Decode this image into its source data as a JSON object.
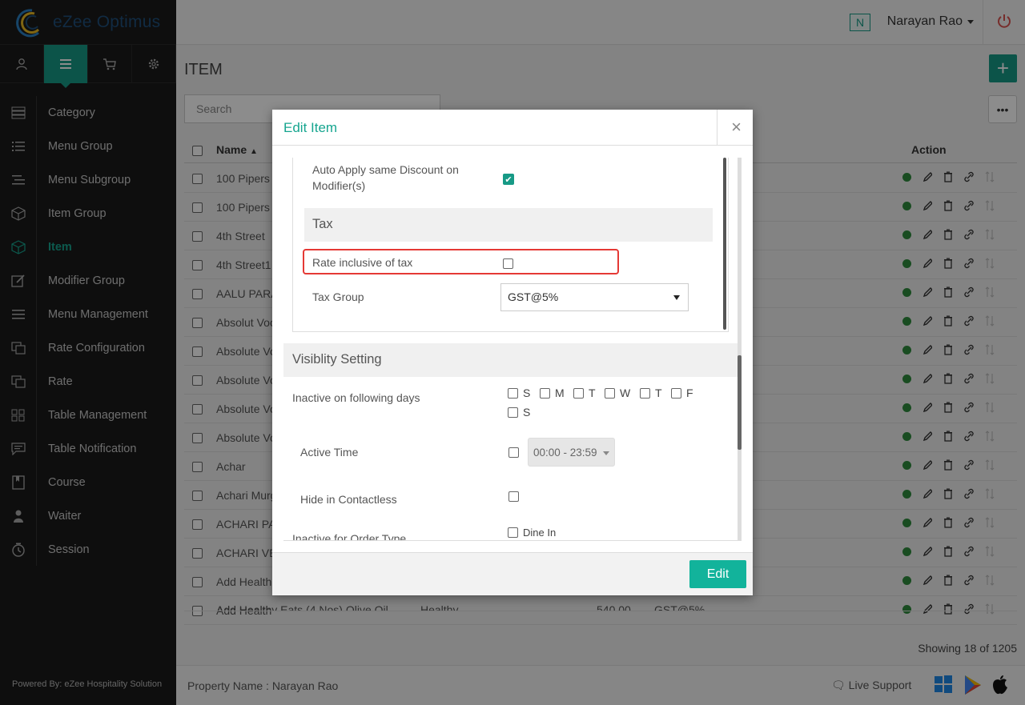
{
  "app": {
    "name": "eZee Optimus",
    "powered_by": "Powered By: eZee Hospitality Solution"
  },
  "user": {
    "initial": "N",
    "name": "Narayan Rao"
  },
  "sidebar": {
    "tabs": [
      "user-icon",
      "menu-icon",
      "cart-icon",
      "gear-icon"
    ],
    "items": [
      {
        "label": "Category",
        "icon": "category-icon"
      },
      {
        "label": "Menu Group",
        "icon": "list-icon"
      },
      {
        "label": "Menu Subgroup",
        "icon": "sublist-icon"
      },
      {
        "label": "Item Group",
        "icon": "cube-icon"
      },
      {
        "label": "Item",
        "icon": "cube-icon",
        "active": true
      },
      {
        "label": "Modifier Group",
        "icon": "edit-icon"
      },
      {
        "label": "Menu Management",
        "icon": "bars-icon"
      },
      {
        "label": "Rate Configuration",
        "icon": "copy-icon"
      },
      {
        "label": "Rate",
        "icon": "copy-icon"
      },
      {
        "label": "Table Management",
        "icon": "grid-icon"
      },
      {
        "label": "Table Notification",
        "icon": "chat-icon"
      },
      {
        "label": "Course",
        "icon": "book-icon"
      },
      {
        "label": "Waiter",
        "icon": "person-icon"
      },
      {
        "label": "Session",
        "icon": "clock-icon"
      }
    ]
  },
  "main": {
    "title": "ITEM",
    "search_placeholder": "Search",
    "col_name": "Name",
    "col_action": "Action",
    "rows": [
      "100 Pipers",
      "100 Pipers",
      "4th Street",
      "4th Street1",
      "AALU PARA",
      "Absolut Voc",
      "Absolute Vo",
      "Absolute Vo",
      "Absolute Vo",
      "Absolute Vo",
      "Achar",
      "Achari Murg",
      "ACHARI PA",
      "ACHARI VE",
      "Add Health",
      "Add Health"
    ],
    "partial_row": {
      "name": "Add Healthy Eats (4 Nos) Olive Oil",
      "group": "Healthy",
      "price": "540.00",
      "tax": "GST@5%"
    },
    "showing": "Showing 18 of 1205"
  },
  "footer": {
    "property": "Property Name : Narayan Rao",
    "live_support": "Live Support"
  },
  "modal": {
    "title": "Edit Item",
    "close": "×",
    "auto_apply_label": "Auto Apply same Discount on Modifier(s)",
    "auto_apply_checked": true,
    "tax_section": "Tax",
    "rate_inclusive_label": "Rate inclusive of tax",
    "rate_inclusive_checked": false,
    "tax_group_label": "Tax Group",
    "tax_group_value": "GST@5%",
    "visibility_section": "Visiblity Setting",
    "inactive_days_label": "Inactive on following days",
    "days": [
      "S",
      "M",
      "T",
      "W",
      "T",
      "F",
      "S"
    ],
    "active_time_label": "Active Time",
    "active_time_value": "00:00 - 23:59",
    "hide_contactless_label": "Hide in Contactless",
    "inactive_order_type_label": "Inactive for Order Type",
    "order_type_first": "Dine In",
    "edit_button": "Edit"
  }
}
